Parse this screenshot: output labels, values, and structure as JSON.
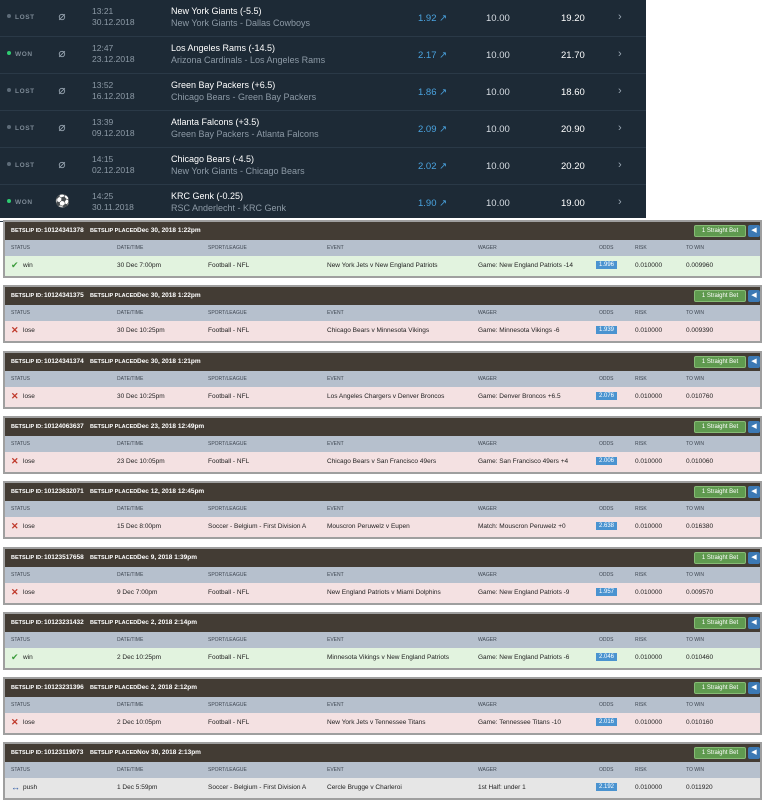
{
  "top_bets": [
    {
      "status": "LOST",
      "won": false,
      "sport_icon": "football-icon",
      "time": "13:21",
      "date": "30.12.2018",
      "selection": "New York Giants (-5.5)",
      "event": "New York Giants - Dallas Cowboys",
      "odds": "1.92",
      "stake": "10.00",
      "return": "19.20"
    },
    {
      "status": "WON",
      "won": true,
      "sport_icon": "football-icon",
      "time": "12:47",
      "date": "23.12.2018",
      "selection": "Los Angeles Rams (-14.5)",
      "event": "Arizona Cardinals - Los Angeles Rams",
      "odds": "2.17",
      "stake": "10.00",
      "return": "21.70"
    },
    {
      "status": "LOST",
      "won": false,
      "sport_icon": "football-icon",
      "time": "13:52",
      "date": "16.12.2018",
      "selection": "Green Bay Packers (+6.5)",
      "event": "Chicago Bears - Green Bay Packers",
      "odds": "1.86",
      "stake": "10.00",
      "return": "18.60"
    },
    {
      "status": "LOST",
      "won": false,
      "sport_icon": "football-icon",
      "time": "13:39",
      "date": "09.12.2018",
      "selection": "Atlanta Falcons (+3.5)",
      "event": "Green Bay Packers - Atlanta Falcons",
      "odds": "2.09",
      "stake": "10.00",
      "return": "20.90"
    },
    {
      "status": "LOST",
      "won": false,
      "sport_icon": "football-icon",
      "time": "14:15",
      "date": "02.12.2018",
      "selection": "Chicago Bears (-4.5)",
      "event": "New York Giants - Chicago Bears",
      "odds": "2.02",
      "stake": "10.00",
      "return": "20.20"
    },
    {
      "status": "WON",
      "won": true,
      "sport_icon": "soccer-ball-icon",
      "time": "14:25",
      "date": "30.11.2018",
      "selection": "KRC Genk (-0.25)",
      "event": "RSC Anderlecht - KRC Genk",
      "odds": "1.90",
      "stake": "10.00",
      "return": "19.00"
    }
  ],
  "slip_labels": {
    "betslip_id": "BETSLIP ID:",
    "betslip_placed": "BETSLIP PLACED:",
    "badge": "1 Straight Bet",
    "col_status": "STATUS",
    "col_datetime": "DATE/TIME",
    "col_sport": "SPORT/LEAGUE",
    "col_event": "EVENT",
    "col_wager": "WAGER",
    "col_odds": "ODDS",
    "col_risk": "RISK",
    "col_towin": "TO WIN"
  },
  "betslips": [
    {
      "id": "10124341378",
      "placed": "Dec 30, 2018 1:22pm",
      "status": "win",
      "datetime": "30 Dec 7:00pm",
      "sport": "Football - NFL",
      "event": "New York Jets v New England Patriots",
      "wager": "Game: New England Patriots -14",
      "odds": "1.996",
      "risk": "0.010000",
      "to_win": "0.009960"
    },
    {
      "id": "10124341375",
      "placed": "Dec 30, 2018 1:22pm",
      "status": "lose",
      "datetime": "30 Dec 10:25pm",
      "sport": "Football - NFL",
      "event": "Chicago Bears v Minnesota Vikings",
      "wager": "Game: Minnesota Vikings -6",
      "odds": "1.939",
      "risk": "0.010000",
      "to_win": "0.009390"
    },
    {
      "id": "10124341374",
      "placed": "Dec 30, 2018 1:21pm",
      "status": "lose",
      "datetime": "30 Dec 10:25pm",
      "sport": "Football - NFL",
      "event": "Los Angeles Chargers v Denver Broncos",
      "wager": "Game: Denver Broncos +6.5",
      "odds": "2.076",
      "risk": "0.010000",
      "to_win": "0.010760"
    },
    {
      "id": "10124063637",
      "placed": "Dec 23, 2018 12:49pm",
      "status": "lose",
      "datetime": "23 Dec 10:05pm",
      "sport": "Football - NFL",
      "event": "Chicago Bears v San Francisco 49ers",
      "wager": "Game: San Francisco 49ers +4",
      "odds": "2.006",
      "risk": "0.010000",
      "to_win": "0.010060"
    },
    {
      "id": "10123632071",
      "placed": "Dec 12, 2018 12:45pm",
      "status": "lose",
      "datetime": "15 Dec 8:00pm",
      "sport": "Soccer - Belgium - First Division A",
      "event": "Mouscron Peruwelz v Eupen",
      "wager": "Match: Mouscron Peruwelz +0",
      "odds": "2.638",
      "risk": "0.010000",
      "to_win": "0.016380"
    },
    {
      "id": "10123517658",
      "placed": "Dec 9, 2018 1:39pm",
      "status": "lose",
      "datetime": "9 Dec 7:00pm",
      "sport": "Football - NFL",
      "event": "New England Patriots v Miami Dolphins",
      "wager": "Game: New England Patriots -9",
      "odds": "1.957",
      "risk": "0.010000",
      "to_win": "0.009570"
    },
    {
      "id": "10123231432",
      "placed": "Dec 2, 2018 2:14pm",
      "status": "win",
      "datetime": "2 Dec 10:25pm",
      "sport": "Football - NFL",
      "event": "Minnesota Vikings v New England Patriots",
      "wager": "Game: New England Patriots -6",
      "odds": "2.046",
      "risk": "0.010000",
      "to_win": "0.010460"
    },
    {
      "id": "10123231396",
      "placed": "Dec 2, 2018 2:12pm",
      "status": "lose",
      "datetime": "2 Dec 10:05pm",
      "sport": "Football - NFL",
      "event": "New York Jets v Tennessee Titans",
      "wager": "Game: Tennessee Titans -10",
      "odds": "2.016",
      "risk": "0.010000",
      "to_win": "0.010160"
    },
    {
      "id": "10123119073",
      "placed": "Nov 30, 2018 2:13pm",
      "status": "push",
      "datetime": "1 Dec 5:59pm",
      "sport": "Soccer - Belgium - First Division A",
      "event": "Cercle Brugge v Charleroi",
      "wager": "1st Half: under 1",
      "odds": "2.192",
      "risk": "0.010000",
      "to_win": "0.011920"
    }
  ],
  "colors": {
    "panel": "#1d2a36",
    "won_dot": "#2ecc71",
    "odds_blue": "#4aa3df",
    "slip_header": "#433c34",
    "badge_green": "#5f9a4f"
  }
}
